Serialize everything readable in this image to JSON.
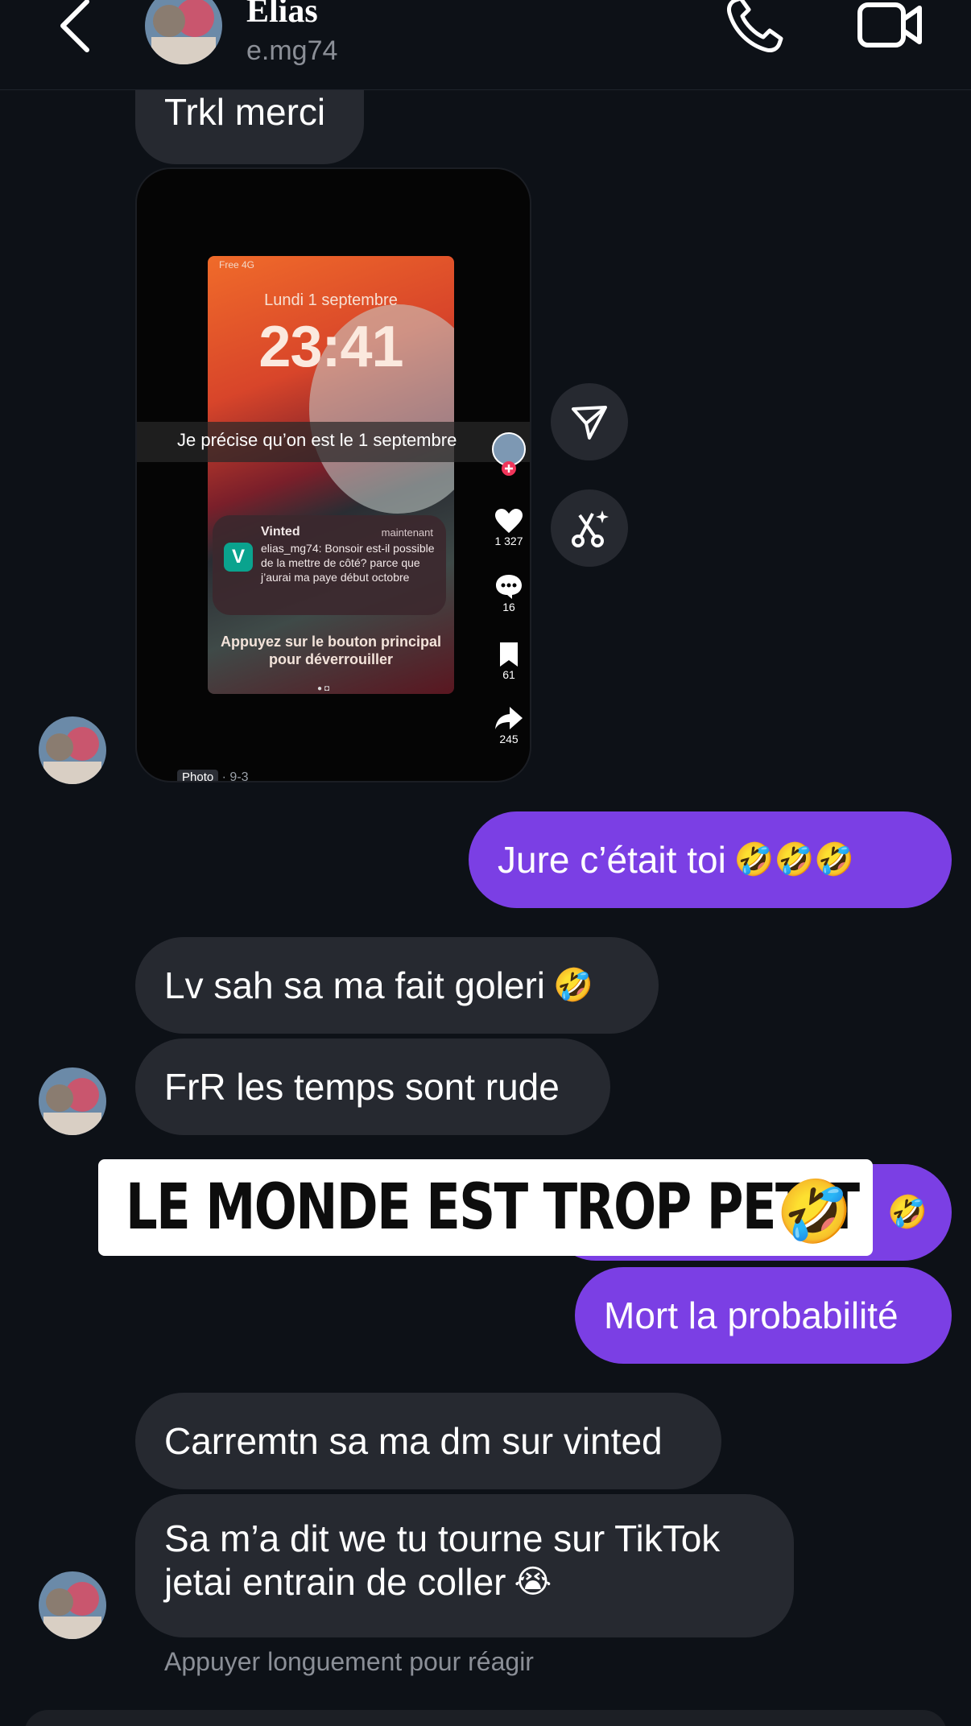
{
  "header": {
    "name": "Elias",
    "handle": "e.mg74"
  },
  "messages": {
    "m1": "Trkl merci",
    "m2_text": "Jure c’était toi",
    "m2_emoji": "🤣🤣🤣",
    "m3_text": "Lv sah sa ma fait goleri",
    "m3_emoji": "🤣",
    "m4": "FrR les temps sont rude",
    "m5_hidden_emoji": "🤣",
    "m6": "Mort la probabilité",
    "m7": "Carremtn sa ma dm sur vinted",
    "m8_line1": "Sa m’a dit we tu tourne sur TikTok",
    "m8_line2": "jetai entrain de coller",
    "m8_emoji": "😭"
  },
  "video": {
    "status": "Free 4G",
    "date": "Lundi 1 septembre",
    "time": "23:41",
    "caption": "Je précise qu’on est le 1 septembre",
    "notif_app": "Vinted",
    "notif_time": "maintenant",
    "notif_body": "elias_mg74: Bonsoir est-il possible de la mettre de côté? parce que j’aurai ma paye début octobre",
    "notif_logo": "V",
    "unlock_line1": "Appuyez sur le bouton principal",
    "unlock_line2": "pour déverrouiller",
    "likes": "1 327",
    "comments": "16",
    "saves": "61",
    "shares": "245",
    "photo_tag": "Photo",
    "footer_date": "· 9-3"
  },
  "overlay": {
    "text": "LE MONDE EST TROP PETIT",
    "emoji": "🤣"
  },
  "hint": "Appuyer longuement pour réagir",
  "colors": {
    "background": "#0d1117",
    "received_bubble": "#262930",
    "sent_bubble": "#7b3fe4"
  },
  "icons": [
    "back-arrow-icon",
    "phone-icon",
    "video-camera-icon",
    "send-icon",
    "scissors-sparkle-icon",
    "heart-icon",
    "comment-icon",
    "bookmark-icon",
    "share-icon"
  ]
}
